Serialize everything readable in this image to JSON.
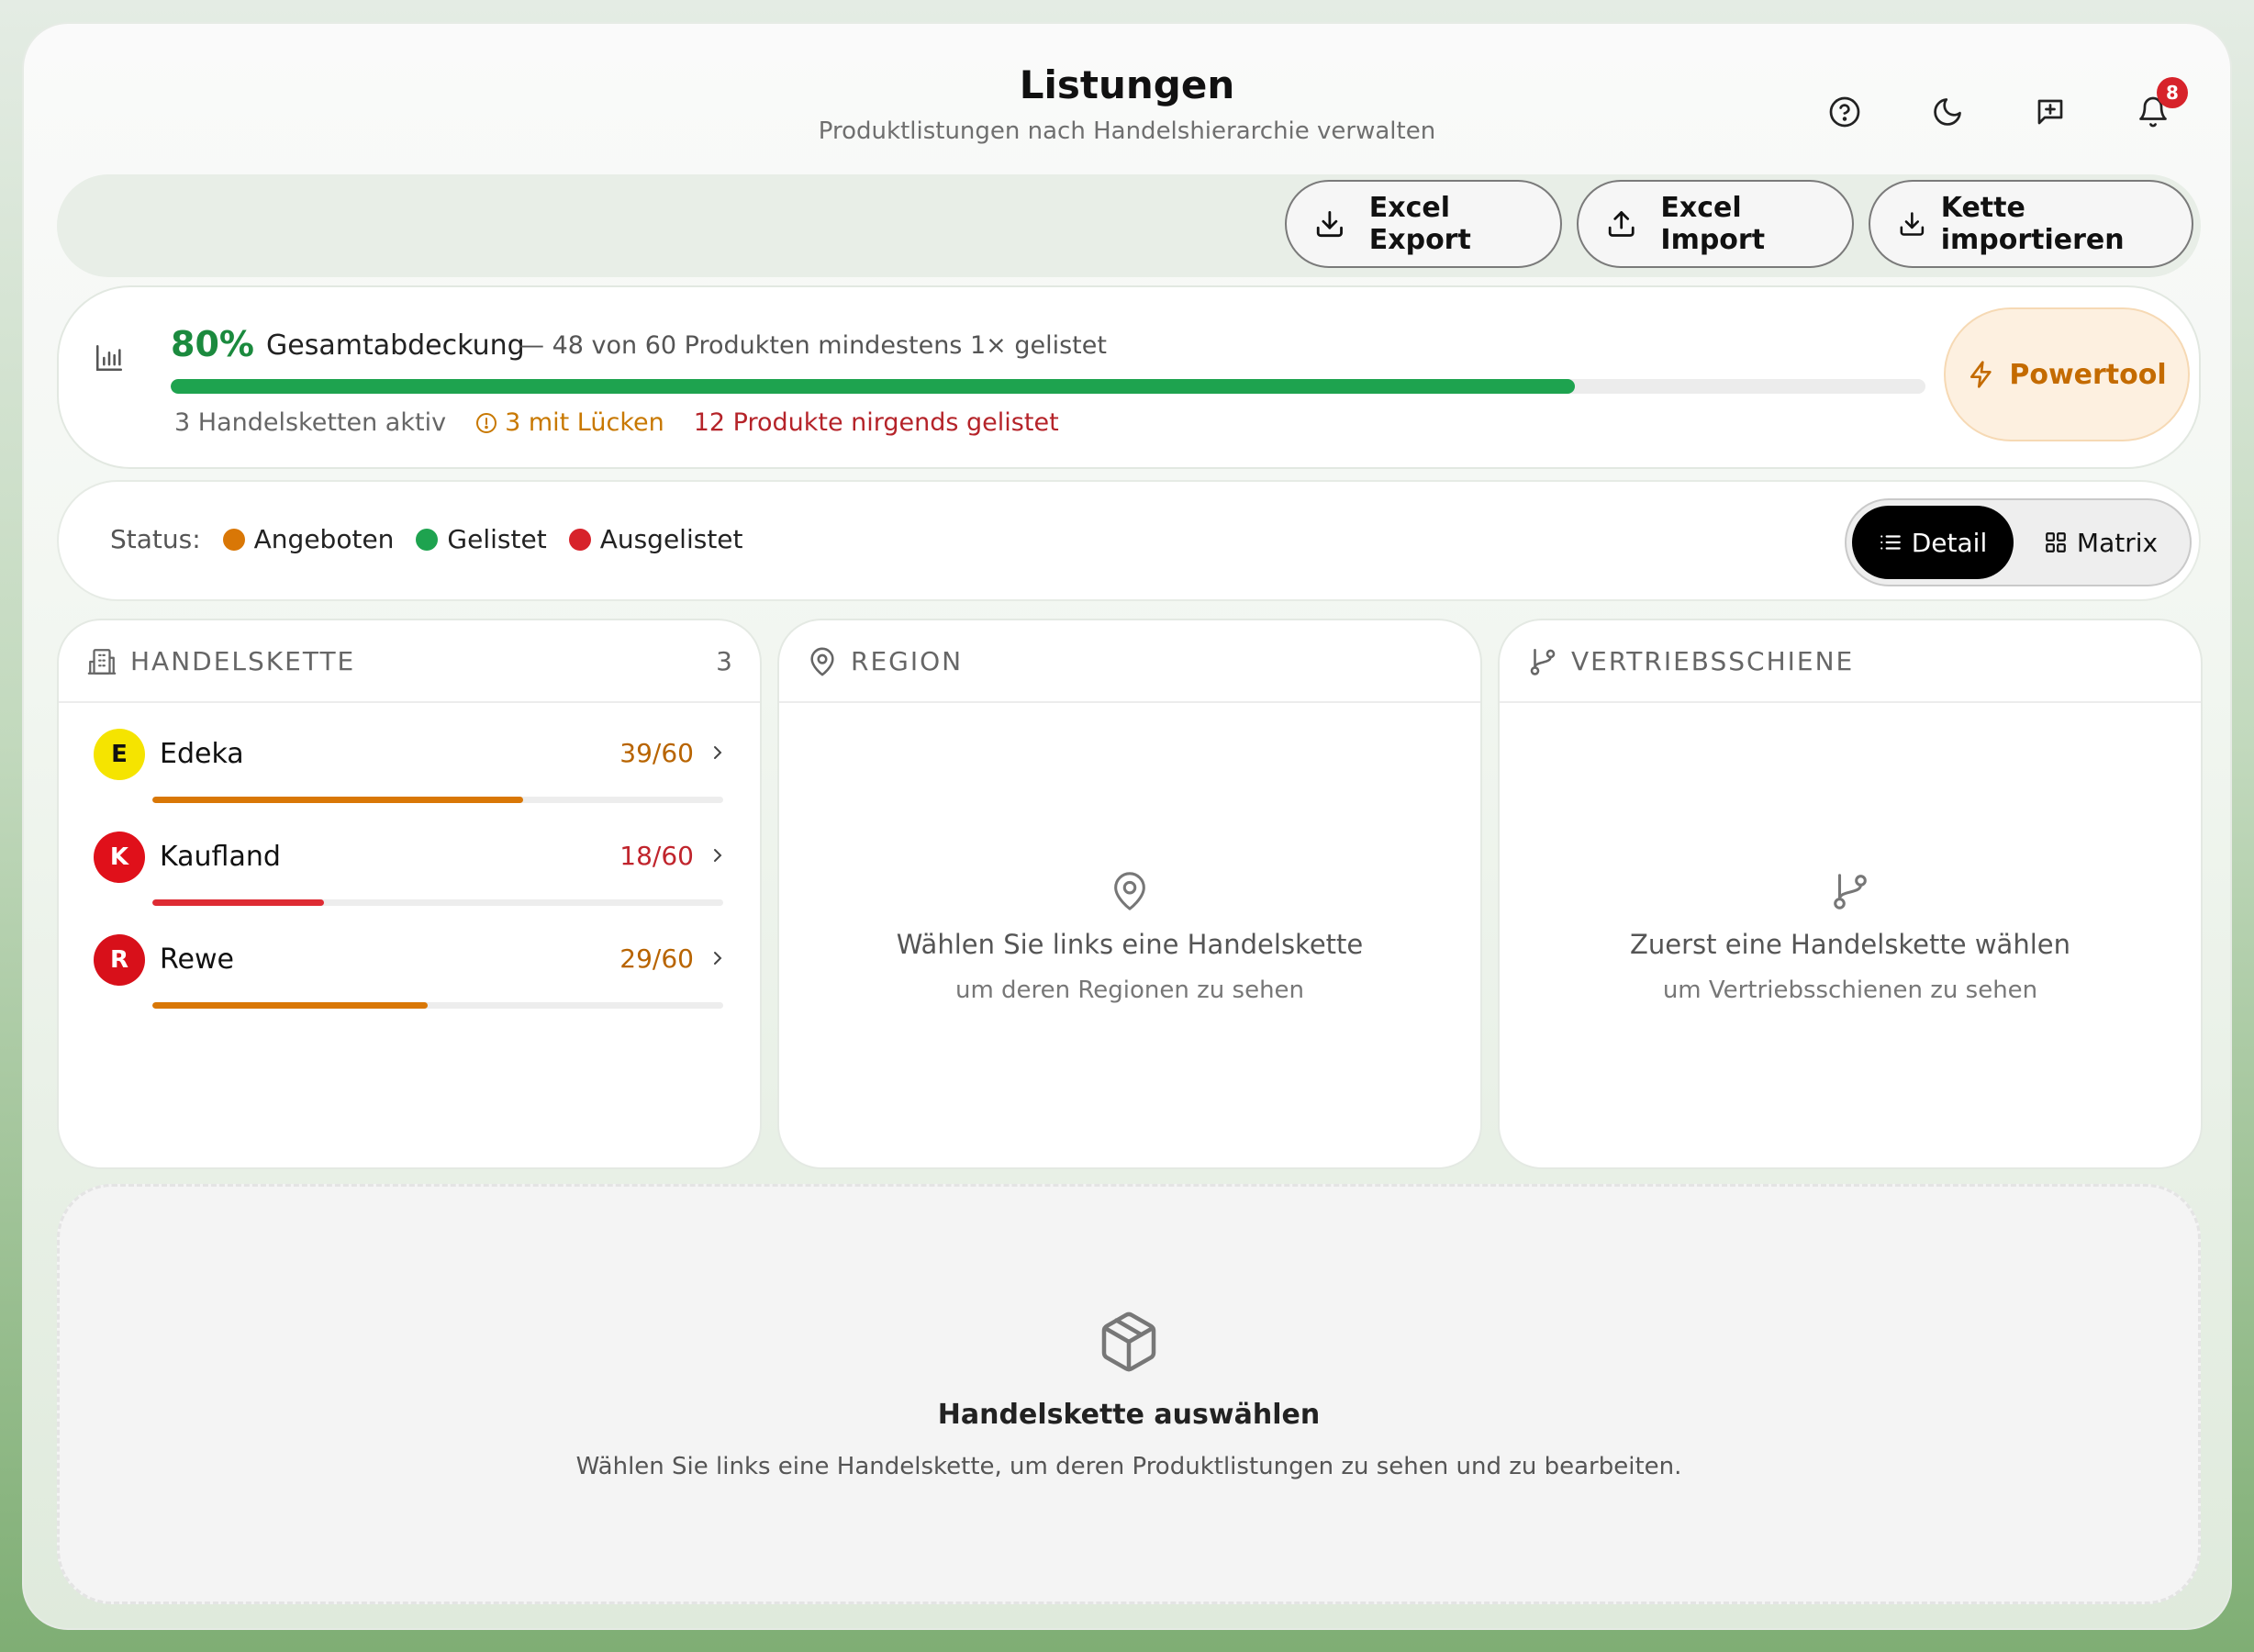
{
  "header": {
    "title": "Listungen",
    "subtitle": "Produktlistungen nach Handelshierarchie verwalten",
    "notification_count": "8",
    "icons": [
      "help-icon",
      "moon-icon",
      "feedback-icon",
      "bell-icon"
    ]
  },
  "toolbar": {
    "excel_export": "Excel Export",
    "excel_import": "Excel Import",
    "chain_import": "Kette importieren"
  },
  "coverage": {
    "percent": "80%",
    "percent_value": 0.8,
    "label": "Gesamtabdeckung",
    "description": "— 48 von 60 Produkten mindestens 1× gelistet",
    "active_chains": "3 Handelsketten aktiv",
    "gaps": "3 mit Lücken",
    "not_listed": "12 Produkte nirgends gelistet",
    "powertool": "Powertool",
    "colors": {
      "bar": "#1ea34f",
      "gaps": "#c87800",
      "not_listed": "#b52329"
    }
  },
  "legend": {
    "label": "Status:",
    "items": [
      {
        "label": "Angeboten",
        "color": "#d97706"
      },
      {
        "label": "Gelistet",
        "color": "#1ea34f"
      },
      {
        "label": "Ausgelistet",
        "color": "#d7232b"
      }
    ],
    "view_detail": "Detail",
    "view_matrix": "Matrix"
  },
  "chains_panel": {
    "title": "HANDELSKETTE",
    "count": "3",
    "items": [
      {
        "letter": "E",
        "name": "Edeka",
        "value": "39/60",
        "fraction": 0.65,
        "avatar_bg": "#f5e400",
        "avatar_fg": "#111111",
        "value_color": "#b86400",
        "bar_color": "#d97706"
      },
      {
        "letter": "K",
        "name": "Kaufland",
        "value": "18/60",
        "fraction": 0.3,
        "avatar_bg": "#e0101a",
        "avatar_fg": "#ffffff",
        "value_color": "#c0242c",
        "bar_color": "#de2b33"
      },
      {
        "letter": "R",
        "name": "Rewe",
        "value": "29/60",
        "fraction": 0.483,
        "avatar_bg": "#d8101a",
        "avatar_fg": "#ffffff",
        "value_color": "#b86400",
        "bar_color": "#d97706"
      }
    ]
  },
  "region_panel": {
    "title": "REGION",
    "empty_title": "Wählen Sie links eine Handelskette",
    "empty_sub": "um deren Regionen zu sehen"
  },
  "channel_panel": {
    "title": "VERTRIEBSSCHIENE",
    "empty_title": "Zuerst eine Handelskette wählen",
    "empty_sub": "um Vertriebsschienen zu sehen"
  },
  "product_area": {
    "title": "Handelskette auswählen",
    "description": "Wählen Sie links eine Handelskette, um deren Produktlistungen zu sehen und zu bearbeiten."
  }
}
